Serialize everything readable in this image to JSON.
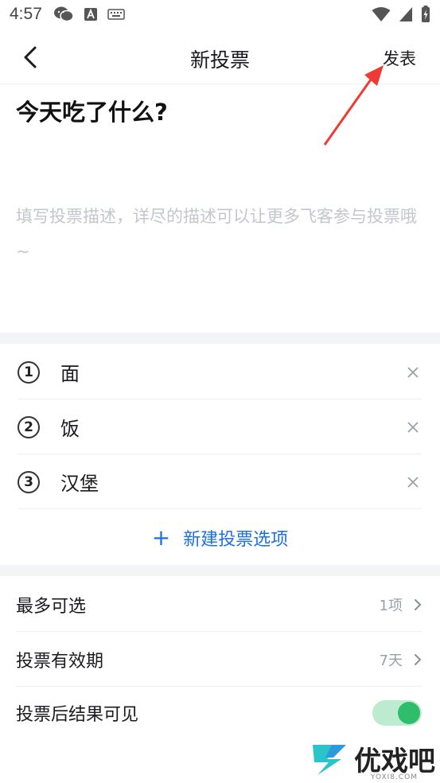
{
  "status_bar": {
    "time": "4:57"
  },
  "nav": {
    "title": "新投票",
    "publish_label": "发表"
  },
  "poll": {
    "title": "今天吃了什么?",
    "description_placeholder": "填写投票描述，详尽的描述可以让更多飞客参与投票哦~"
  },
  "options": [
    {
      "num": "1",
      "label": "面"
    },
    {
      "num": "2",
      "label": "饭"
    },
    {
      "num": "3",
      "label": "汉堡"
    }
  ],
  "add_option_label": "新建投票选项",
  "settings": {
    "max_choices": {
      "label": "最多可选",
      "value": "1项"
    },
    "validity": {
      "label": "投票有效期",
      "value": "7天"
    },
    "visibility": {
      "label": "投票后结果可见",
      "enabled": true
    }
  },
  "watermark": {
    "text": "优戏吧",
    "sub": "YOXI8.COM"
  },
  "colors": {
    "accent": "#1e6fe0",
    "toggle_on": "#2ebd6b",
    "annotation_arrow": "#f03a35"
  }
}
